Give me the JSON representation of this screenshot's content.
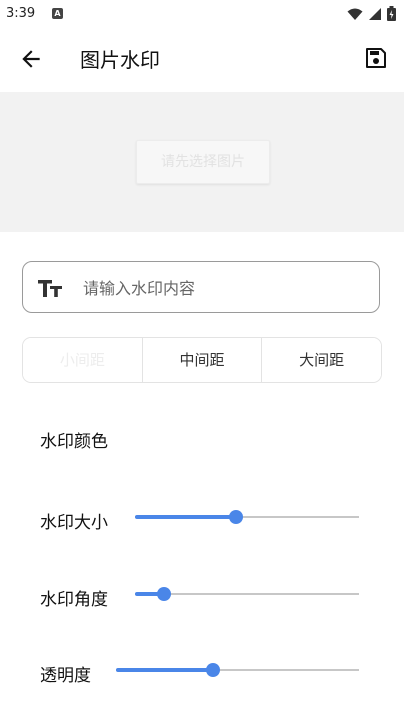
{
  "status_bar": {
    "time": "3:39"
  },
  "app_bar": {
    "title": "图片水印"
  },
  "preview": {
    "select_button_label": "请先选择图片"
  },
  "watermark_input": {
    "placeholder": "请输入水印内容",
    "value": ""
  },
  "spacing": {
    "options": [
      "小间距",
      "中间距",
      "大间距"
    ],
    "selected": "小间距"
  },
  "settings": {
    "color_label": "水印颜色",
    "size": {
      "label": "水印大小",
      "value_fraction": 0.45
    },
    "angle": {
      "label": "水印角度",
      "value_fraction": 0.13
    },
    "opacity": {
      "label": "透明度",
      "value_fraction": 0.4
    }
  },
  "colors": {
    "accent": "#4a86e8",
    "preview_bg": "#f2f2f2",
    "track": "#c7c7c7"
  }
}
